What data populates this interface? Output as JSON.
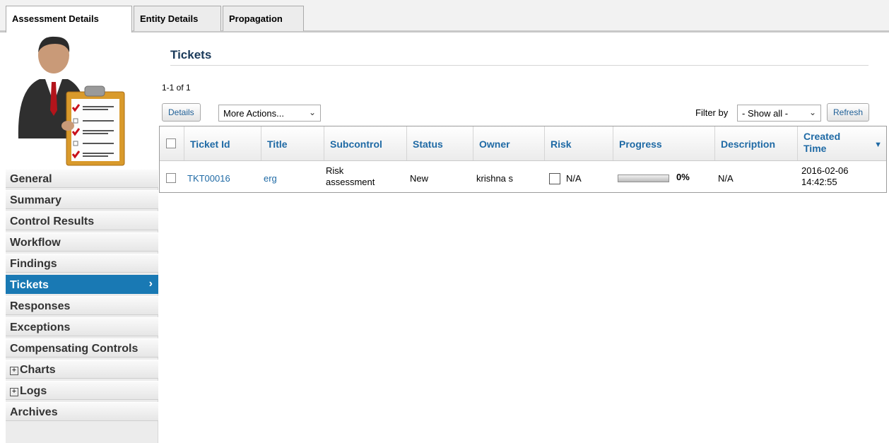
{
  "tabs": [
    {
      "label": "Assessment Details",
      "active": true
    },
    {
      "label": "Entity Details",
      "active": false
    },
    {
      "label": "Propagation",
      "active": false
    }
  ],
  "sidebar": {
    "items": [
      {
        "label": "General"
      },
      {
        "label": "Summary"
      },
      {
        "label": "Control Results"
      },
      {
        "label": "Workflow"
      },
      {
        "label": "Findings"
      },
      {
        "label": "Tickets",
        "active": true
      },
      {
        "label": "Responses"
      },
      {
        "label": "Exceptions"
      },
      {
        "label": "Compensating Controls"
      },
      {
        "label": "Charts",
        "expandable": true
      },
      {
        "label": "Logs",
        "expandable": true
      },
      {
        "label": "Archives"
      }
    ],
    "active_color": "#1979b4"
  },
  "main": {
    "title": "Tickets",
    "pager": "1-1 of 1",
    "toolbar": {
      "details_label": "Details",
      "more_actions_label": "More Actions...",
      "filter_label": "Filter by",
      "filter_value": "- Show all -",
      "refresh_label": "Refresh"
    },
    "table": {
      "headers": [
        "Ticket Id",
        "Title",
        "Subcontrol",
        "Status",
        "Owner",
        "Risk",
        "Progress",
        "Description",
        "Created Time"
      ],
      "rows": [
        {
          "ticket_id": "TKT00016",
          "title": "erg",
          "subcontrol": "Risk assessment",
          "status": "New",
          "owner": "krishna s",
          "risk": "N/A",
          "progress": "0%",
          "progress_value": 0,
          "description": "N/A",
          "created_time": "2016-02-06 14:42:55"
        }
      ]
    }
  },
  "colors": {
    "link": "#1f6aa5",
    "title": "#1a3a5a"
  }
}
